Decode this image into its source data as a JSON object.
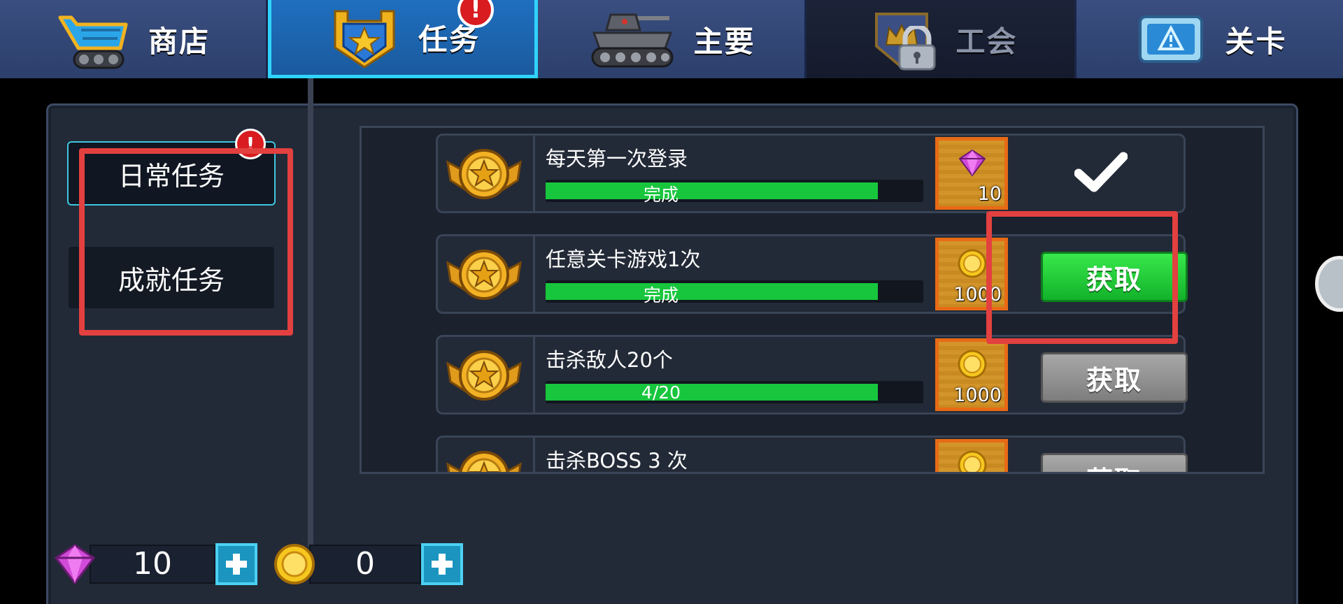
{
  "tabs": [
    {
      "label": "商店",
      "icon": "shop-cart-icon",
      "active": false,
      "alert": false,
      "locked": false
    },
    {
      "label": "任务",
      "icon": "quest-shield-icon",
      "active": true,
      "alert": true,
      "locked": false
    },
    {
      "label": "主要",
      "icon": "tank-icon",
      "active": false,
      "alert": false,
      "locked": false
    },
    {
      "label": "工会",
      "icon": "guild-crown-icon",
      "active": false,
      "alert": false,
      "locked": true
    },
    {
      "label": "关卡",
      "icon": "level-tablet-icon",
      "active": false,
      "alert": false,
      "locked": false
    }
  ],
  "alert_mark": "!",
  "sidebar": {
    "daily": {
      "label": "日常任务",
      "selected": true,
      "alert": true
    },
    "achievement": {
      "label": "成就任务",
      "selected": false,
      "alert": false
    }
  },
  "quests": [
    {
      "title": "每天第一次登录",
      "progress_text": "完成",
      "progress": 1.0,
      "reward_type": "gem",
      "reward_amount": "10",
      "state": "claimed",
      "claim_label": ""
    },
    {
      "title": "任意关卡游戏1次",
      "progress_text": "完成",
      "progress": 1.0,
      "reward_type": "coin",
      "reward_amount": "1000",
      "state": "claimable",
      "claim_label": "获取"
    },
    {
      "title": "击杀敌人20个",
      "progress_text": "4/20",
      "progress": 1.0,
      "reward_type": "coin",
      "reward_amount": "1000",
      "state": "locked",
      "claim_label": "获取"
    },
    {
      "title": "击杀BOSS 3 次",
      "progress_text": "",
      "progress": 0,
      "reward_type": "coin",
      "reward_amount": "",
      "state": "locked",
      "claim_label": "获取"
    }
  ],
  "currency": {
    "gems": {
      "value": "10",
      "icon": "gem-icon"
    },
    "coins": {
      "value": "0",
      "icon": "coin-icon"
    }
  },
  "colors": {
    "active_tab_border": "#2fd3ff",
    "progress_green": "#17c63d",
    "claim_green": "#22c935",
    "alert_red": "#d81c20",
    "highlight_red": "#e34040",
    "reward_orange": "#e86a15"
  }
}
